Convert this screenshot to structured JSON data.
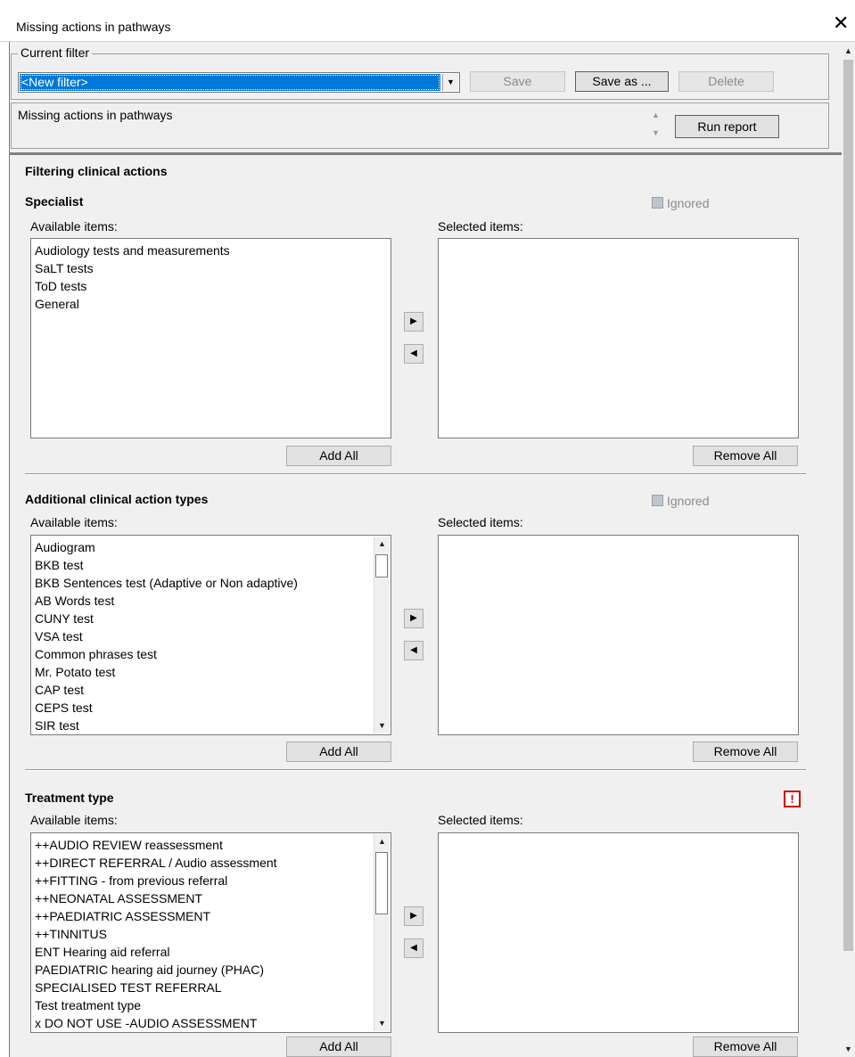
{
  "window": {
    "title": "Missing actions in pathways",
    "close_glyph": "✕"
  },
  "filter": {
    "legend": "Current filter",
    "selected": "<New filter>",
    "save_label": "Save",
    "save_as_label": "Save as ...",
    "delete_label": "Delete"
  },
  "report": {
    "name": "Missing actions in pathways",
    "run_label": "Run report"
  },
  "main": {
    "heading": "Filtering clinical actions"
  },
  "sections": [
    {
      "title": "Specialist",
      "ignored_label": "Ignored",
      "available_label": "Available items:",
      "selected_label": "Selected items:",
      "available_items": [
        "Audiology tests and measurements",
        "SaLT tests",
        "ToD tests",
        "General"
      ],
      "add_all": "Add All",
      "remove_all": "Remove All"
    },
    {
      "title": "Additional clinical action types",
      "ignored_label": "Ignored",
      "available_label": "Available items:",
      "selected_label": "Selected items:",
      "available_items": [
        "Audiogram",
        "BKB test",
        "BKB Sentences test (Adaptive or Non adaptive)",
        "AB Words test",
        "CUNY test",
        "VSA test",
        "Common phrases test",
        "Mr. Potato test",
        "CAP test",
        "CEPS test",
        "SIR test"
      ],
      "add_all": "Add All",
      "remove_all": "Remove All"
    },
    {
      "title": "Treatment type",
      "warning_glyph": "!",
      "available_label": "Available items:",
      "selected_label": "Selected items:",
      "available_items": [
        "++AUDIO REVIEW reassessment",
        "++DIRECT REFERRAL / Audio assessment",
        "++FITTING - from previous referral",
        "++NEONATAL ASSESSMENT",
        "++PAEDIATRIC ASSESSMENT",
        "++TINNITUS",
        "ENT Hearing aid referral",
        "PAEDIATRIC hearing aid journey (PHAC)",
        "SPECIALISED TEST REFERRAL",
        "Test treatment type",
        "x DO NOT USE -AUDIO ASSESSMENT"
      ],
      "add_all": "Add All",
      "remove_all": "Remove All"
    }
  ]
}
